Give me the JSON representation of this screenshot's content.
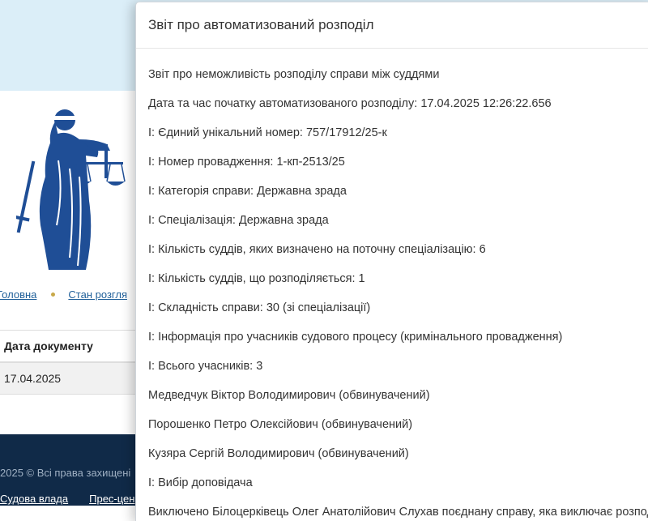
{
  "background": {
    "breadcrumbs": [
      "Головна",
      "Стан розгля"
    ],
    "table": {
      "header": "Дата документу",
      "cell": "17.04.2025"
    },
    "footer": {
      "copyright": "2025 © Всі права захищені",
      "links": [
        "Судова влада",
        "Прес-цен"
      ]
    }
  },
  "modal": {
    "title": "Звіт про автоматизований розподіл",
    "lines": [
      "Звіт про неможливість розподілу справи між суддями",
      "Дата та час початку автоматизованого розподілу: 17.04.2025 12:26:22.656",
      "І: Єдиний унікальний номер: 757/17912/25-к",
      "І: Номер провадження: 1-кп-2513/25",
      "І: Категорія справи: Державна зрада",
      "І: Спеціалізація: Державна зрада",
      "І: Кількість суддів, яких визначено на поточну спеціалізацію: 6",
      "І: Кількість суддів, що розподіляється: 1",
      "І: Складність справи: 30 (зі спеціалізації)",
      "І: Інформація про учасників судового процесу (кримінального провадження)",
      "І: Всього учасників: 3",
      "Медведчук Віктор Володимирович (обвинувачений)",
      "Порошенко Петро Олексійович (обвинувачений)",
      "Кузяра Сергій Володимирович (обвинувачений)",
      "І: Вибір доповідача",
      "Виключено Білоцерківець Олег Анатолійович Слухав поєднану справу, яка виключає розподіл"
    ]
  },
  "colors": {
    "header_bg": "#dbeef8",
    "footer_bg": "#102a48",
    "logo": "#1f4e96",
    "link": "#1f5f99"
  }
}
